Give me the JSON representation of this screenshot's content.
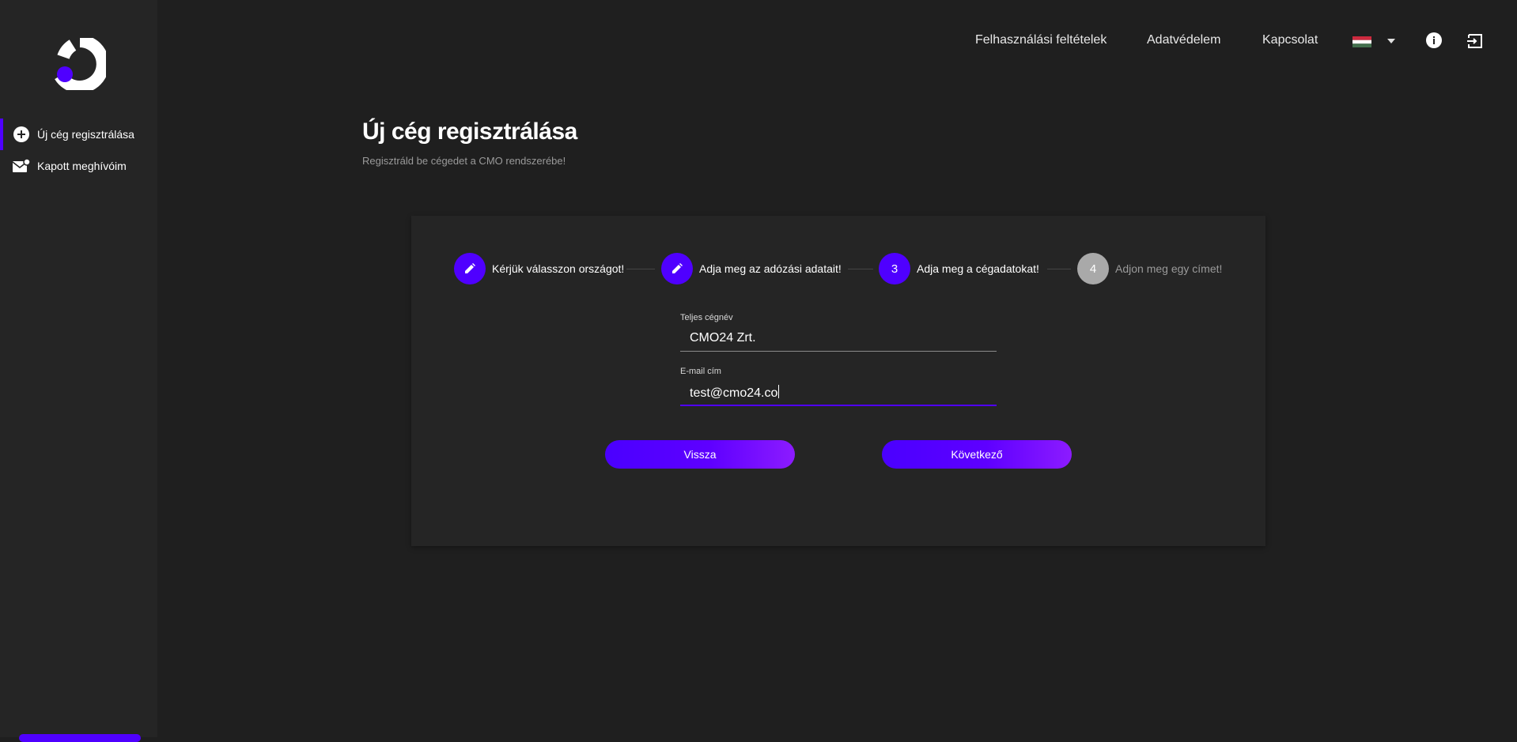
{
  "sidebar": {
    "logo": "cmo-logo",
    "items": [
      {
        "label": "Új cég regisztrálása",
        "icon": "add-circle-icon",
        "active": true
      },
      {
        "label": "Kapott meghívóim",
        "icon": "mail-notification-icon",
        "active": false
      }
    ]
  },
  "header": {
    "links": [
      "Felhasználási feltételek",
      "Adatvédelem",
      "Kapcsolat"
    ],
    "language_icon": "hungarian-flag-icon",
    "info_icon": "info-icon",
    "logout_icon": "logout-icon"
  },
  "page": {
    "title": "Új cég regisztrálása",
    "subtitle": "Regisztráld be cégedet a CMO rendszerébe!"
  },
  "stepper": {
    "steps": [
      {
        "label": "Kérjük válasszon országot!",
        "state": "completed",
        "icon": "edit-icon"
      },
      {
        "label": "Adja meg az adózási adatait!",
        "state": "completed",
        "icon": "edit-icon"
      },
      {
        "label": "Adja meg a cégadatokat!",
        "state": "active",
        "number": "3"
      },
      {
        "label": "Adjon meg egy címet!",
        "state": "inactive",
        "number": "4"
      }
    ]
  },
  "form": {
    "company_name_label": "Teljes cégnév",
    "company_name_value": "CMO24 Zrt.",
    "email_label": "E-mail cím",
    "email_value": "test@cmo24.co"
  },
  "buttons": {
    "back": "Vissza",
    "next": "Következő"
  },
  "colors": {
    "accent": "#4f00ff",
    "background": "#1f1f1f",
    "panel": "#252525"
  }
}
